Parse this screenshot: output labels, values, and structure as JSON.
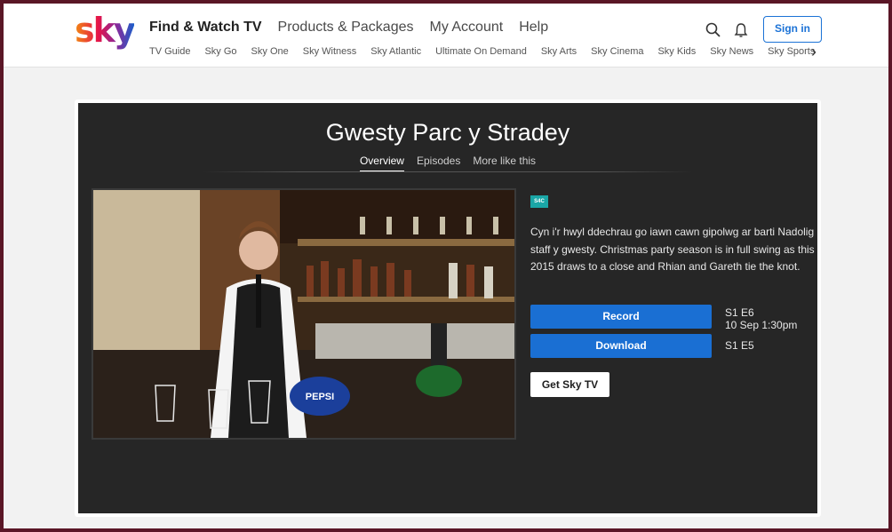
{
  "header": {
    "logo": "sky",
    "main_nav": [
      "Find & Watch TV",
      "Products & Packages",
      "My Account",
      "Help"
    ],
    "sub_nav": [
      "TV Guide",
      "Sky Go",
      "Sky One",
      "Sky Witness",
      "Sky Atlantic",
      "Ultimate On Demand",
      "Sky Arts",
      "Sky Cinema",
      "Sky Kids",
      "Sky News",
      "Sky Sports"
    ],
    "sign_in_label": "Sign in",
    "icons": [
      "search-icon",
      "bell-icon",
      "chevron-right-icon"
    ]
  },
  "programme": {
    "title": "Gwesty Parc y Stradey",
    "tabs": [
      "Overview",
      "Episodes",
      "More like this"
    ],
    "active_tab": "Overview",
    "channel_logo": "S4C",
    "description": "Cyn i'r hwyl ddechrau go iawn cawn gipolwg ar barti Nadolig staff y gwesty. Christmas party season is in full swing as this 2015 draws to a close and Rhian and Gareth tie the knot.",
    "record_label": "Record",
    "download_label": "Download",
    "record_episode": "S1 E6",
    "record_time": "10 Sep 1:30pm",
    "download_episode": "S1 E5",
    "get_sky_label": "Get Sky TV"
  },
  "colors": {
    "accent_blue": "#1a6fd3",
    "panel_bg": "#262626",
    "outer_bg": "#5a1626"
  }
}
